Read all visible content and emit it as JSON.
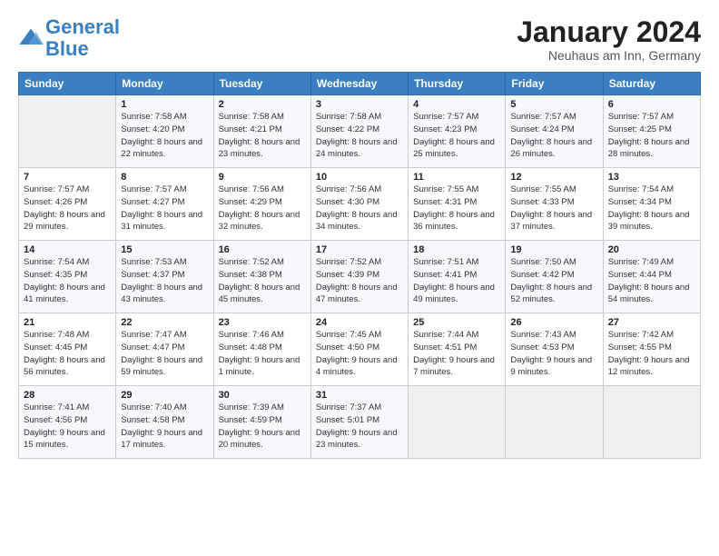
{
  "header": {
    "logo_line1": "General",
    "logo_line2": "Blue",
    "month_title": "January 2024",
    "location": "Neuhaus am Inn, Germany"
  },
  "weekdays": [
    "Sunday",
    "Monday",
    "Tuesday",
    "Wednesday",
    "Thursday",
    "Friday",
    "Saturday"
  ],
  "weeks": [
    [
      {
        "day": "",
        "sunrise": "",
        "sunset": "",
        "daylight": ""
      },
      {
        "day": "1",
        "sunrise": "7:58 AM",
        "sunset": "4:20 PM",
        "daylight": "8 hours and 22 minutes."
      },
      {
        "day": "2",
        "sunrise": "7:58 AM",
        "sunset": "4:21 PM",
        "daylight": "8 hours and 23 minutes."
      },
      {
        "day": "3",
        "sunrise": "7:58 AM",
        "sunset": "4:22 PM",
        "daylight": "8 hours and 24 minutes."
      },
      {
        "day": "4",
        "sunrise": "7:57 AM",
        "sunset": "4:23 PM",
        "daylight": "8 hours and 25 minutes."
      },
      {
        "day": "5",
        "sunrise": "7:57 AM",
        "sunset": "4:24 PM",
        "daylight": "8 hours and 26 minutes."
      },
      {
        "day": "6",
        "sunrise": "7:57 AM",
        "sunset": "4:25 PM",
        "daylight": "8 hours and 28 minutes."
      }
    ],
    [
      {
        "day": "7",
        "sunrise": "7:57 AM",
        "sunset": "4:26 PM",
        "daylight": "8 hours and 29 minutes."
      },
      {
        "day": "8",
        "sunrise": "7:57 AM",
        "sunset": "4:27 PM",
        "daylight": "8 hours and 31 minutes."
      },
      {
        "day": "9",
        "sunrise": "7:56 AM",
        "sunset": "4:29 PM",
        "daylight": "8 hours and 32 minutes."
      },
      {
        "day": "10",
        "sunrise": "7:56 AM",
        "sunset": "4:30 PM",
        "daylight": "8 hours and 34 minutes."
      },
      {
        "day": "11",
        "sunrise": "7:55 AM",
        "sunset": "4:31 PM",
        "daylight": "8 hours and 36 minutes."
      },
      {
        "day": "12",
        "sunrise": "7:55 AM",
        "sunset": "4:33 PM",
        "daylight": "8 hours and 37 minutes."
      },
      {
        "day": "13",
        "sunrise": "7:54 AM",
        "sunset": "4:34 PM",
        "daylight": "8 hours and 39 minutes."
      }
    ],
    [
      {
        "day": "14",
        "sunrise": "7:54 AM",
        "sunset": "4:35 PM",
        "daylight": "8 hours and 41 minutes."
      },
      {
        "day": "15",
        "sunrise": "7:53 AM",
        "sunset": "4:37 PM",
        "daylight": "8 hours and 43 minutes."
      },
      {
        "day": "16",
        "sunrise": "7:52 AM",
        "sunset": "4:38 PM",
        "daylight": "8 hours and 45 minutes."
      },
      {
        "day": "17",
        "sunrise": "7:52 AM",
        "sunset": "4:39 PM",
        "daylight": "8 hours and 47 minutes."
      },
      {
        "day": "18",
        "sunrise": "7:51 AM",
        "sunset": "4:41 PM",
        "daylight": "8 hours and 49 minutes."
      },
      {
        "day": "19",
        "sunrise": "7:50 AM",
        "sunset": "4:42 PM",
        "daylight": "8 hours and 52 minutes."
      },
      {
        "day": "20",
        "sunrise": "7:49 AM",
        "sunset": "4:44 PM",
        "daylight": "8 hours and 54 minutes."
      }
    ],
    [
      {
        "day": "21",
        "sunrise": "7:48 AM",
        "sunset": "4:45 PM",
        "daylight": "8 hours and 56 minutes."
      },
      {
        "day": "22",
        "sunrise": "7:47 AM",
        "sunset": "4:47 PM",
        "daylight": "8 hours and 59 minutes."
      },
      {
        "day": "23",
        "sunrise": "7:46 AM",
        "sunset": "4:48 PM",
        "daylight": "9 hours and 1 minute."
      },
      {
        "day": "24",
        "sunrise": "7:45 AM",
        "sunset": "4:50 PM",
        "daylight": "9 hours and 4 minutes."
      },
      {
        "day": "25",
        "sunrise": "7:44 AM",
        "sunset": "4:51 PM",
        "daylight": "9 hours and 7 minutes."
      },
      {
        "day": "26",
        "sunrise": "7:43 AM",
        "sunset": "4:53 PM",
        "daylight": "9 hours and 9 minutes."
      },
      {
        "day": "27",
        "sunrise": "7:42 AM",
        "sunset": "4:55 PM",
        "daylight": "9 hours and 12 minutes."
      }
    ],
    [
      {
        "day": "28",
        "sunrise": "7:41 AM",
        "sunset": "4:56 PM",
        "daylight": "9 hours and 15 minutes."
      },
      {
        "day": "29",
        "sunrise": "7:40 AM",
        "sunset": "4:58 PM",
        "daylight": "9 hours and 17 minutes."
      },
      {
        "day": "30",
        "sunrise": "7:39 AM",
        "sunset": "4:59 PM",
        "daylight": "9 hours and 20 minutes."
      },
      {
        "day": "31",
        "sunrise": "7:37 AM",
        "sunset": "5:01 PM",
        "daylight": "9 hours and 23 minutes."
      },
      {
        "day": "",
        "sunrise": "",
        "sunset": "",
        "daylight": ""
      },
      {
        "day": "",
        "sunrise": "",
        "sunset": "",
        "daylight": ""
      },
      {
        "day": "",
        "sunrise": "",
        "sunset": "",
        "daylight": ""
      }
    ]
  ],
  "labels": {
    "sunrise": "Sunrise:",
    "sunset": "Sunset:",
    "daylight": "Daylight:"
  }
}
